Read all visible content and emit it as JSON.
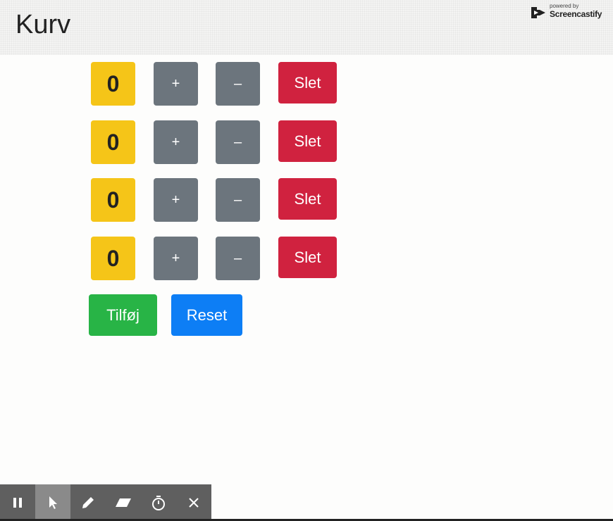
{
  "page": {
    "title": "Kurv"
  },
  "watermark": {
    "powered_by": "powered by",
    "brand": "Screencastify"
  },
  "counters": [
    {
      "value": "0",
      "increment_label": "+",
      "decrement_label": "–",
      "delete_label": "Slet"
    },
    {
      "value": "0",
      "increment_label": "+",
      "decrement_label": "–",
      "delete_label": "Slet"
    },
    {
      "value": "0",
      "increment_label": "+",
      "decrement_label": "–",
      "delete_label": "Slet"
    },
    {
      "value": "0",
      "increment_label": "+",
      "decrement_label": "–",
      "delete_label": "Slet"
    }
  ],
  "actions": {
    "add_label": "Tilføj",
    "reset_label": "Reset"
  },
  "recorder_toolbar": {
    "tools": [
      "pause-icon",
      "cursor-icon",
      "pen-icon",
      "eraser-icon",
      "timer-icon",
      "close-icon"
    ],
    "active_tool": "cursor-icon"
  },
  "colors": {
    "value_badge": "#f5c518",
    "secondary": "#6c757d",
    "danger": "#d0223f",
    "success": "#28b446",
    "primary": "#0d7ef5"
  }
}
